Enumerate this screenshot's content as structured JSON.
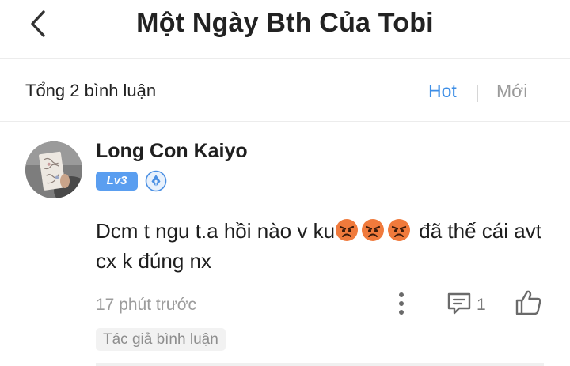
{
  "header": {
    "title": "Một Ngày Bth Của Tobi",
    "back_icon": "chevron-left-icon"
  },
  "sort_bar": {
    "total_label": "Tổng 2 bình luận",
    "options": [
      "Hot",
      "Mới"
    ],
    "selected": "Hot",
    "accent_color": "#3d8ee6",
    "inactive_color": "#9a9a9a"
  },
  "comment": {
    "username": "Long Con Kaiyo",
    "level": "Lv3",
    "level_color": "#5a9ef0",
    "badge_icon": "pen-nib-badge-icon",
    "text_before_emoji": "Dcm t ngu t.a hồi nào v ku",
    "emojis": [
      "angry-face-icon",
      "angry-face-icon",
      "angry-face-icon"
    ],
    "text_after_emoji": " đã thế cái avt cx k đúng nx",
    "time": "17 phút trước",
    "reply_count": "1",
    "author_tag": "Tác giả bình luận"
  }
}
